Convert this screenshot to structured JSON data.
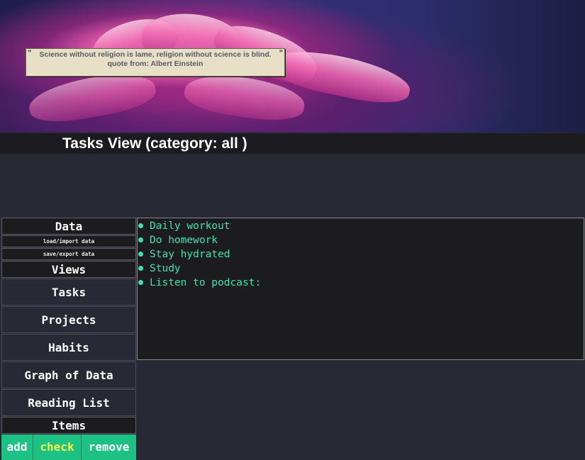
{
  "quote": {
    "text": "Science without religion is lame, religion without science is blind.",
    "author_line": "quote from: Albert Einstein",
    "open_mark": "\"",
    "close_mark": "\""
  },
  "page_title": "Tasks View (category: all )",
  "sidebar": {
    "data_header": "Data",
    "load_label": "load/import data",
    "save_label": "save/export data",
    "views_header": "Views",
    "views": [
      {
        "label": "Tasks"
      },
      {
        "label": "Projects"
      },
      {
        "label": "Habits"
      },
      {
        "label": "Graph of Data"
      },
      {
        "label": "Reading List"
      }
    ],
    "items_header": "Items",
    "items_actions": {
      "add": "add",
      "check": "check",
      "remove": "remove"
    }
  },
  "tasks": [
    "Daily workout",
    "Do homework",
    "Stay hydrated",
    "Study",
    "Listen to podcast:"
  ],
  "colors": {
    "accent_green": "#1ec184",
    "task_text": "#3ee1b4",
    "check_text": "#f4f34a",
    "background": "#272a35"
  }
}
